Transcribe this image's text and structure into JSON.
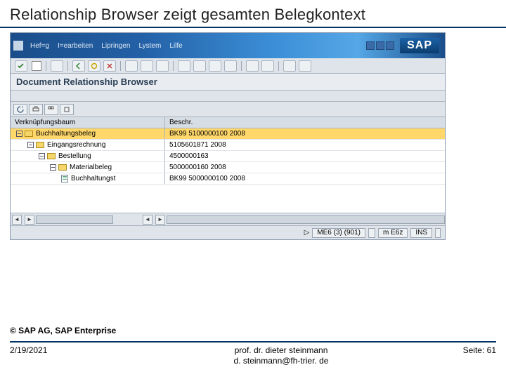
{
  "slide": {
    "title": "Relationship Browser zeigt gesamten Belegkontext"
  },
  "menu": {
    "items": [
      "Hef=g",
      "I=earbeiten",
      "Lipringen",
      "Lystem",
      "Lilfe"
    ]
  },
  "logo": {
    "text": "SAP"
  },
  "doc": {
    "title": "Document Relationship Browser"
  },
  "grid": {
    "col1": "Verknüpfungsbaum",
    "col2": "Beschr.",
    "rows": [
      {
        "label": "Buchhaltungsbeleg",
        "desc": "BK99 5100000100 2008",
        "indent": 0,
        "icon": "folder",
        "expander": true,
        "sel": true
      },
      {
        "label": "Eingangsrechnung",
        "desc": "5105601871 2008",
        "indent": 1,
        "icon": "folder",
        "expander": true,
        "sel": false
      },
      {
        "label": "Bestellung",
        "desc": "4500000163",
        "indent": 2,
        "icon": "folder",
        "expander": true,
        "sel": false
      },
      {
        "label": "Materialbeleg",
        "desc": "5000000160 2008",
        "indent": 3,
        "icon": "folder",
        "expander": true,
        "sel": false
      },
      {
        "label": "Buchhaltungst",
        "desc": "BK99 5000000100 2008",
        "indent": 4,
        "icon": "doc",
        "expander": false,
        "sel": false
      }
    ]
  },
  "status": {
    "sys": "ME6 (3) (901)",
    "host": "m E6z",
    "mode": "INS",
    "arrow": "▷"
  },
  "footer": {
    "copyright": "© SAP AG, SAP Enterprise",
    "date": "2/19/2021",
    "center1": "prof. dr. dieter steinmann",
    "center2": "d. steinmann@fh-trier. de",
    "page": "Seite: 61"
  }
}
